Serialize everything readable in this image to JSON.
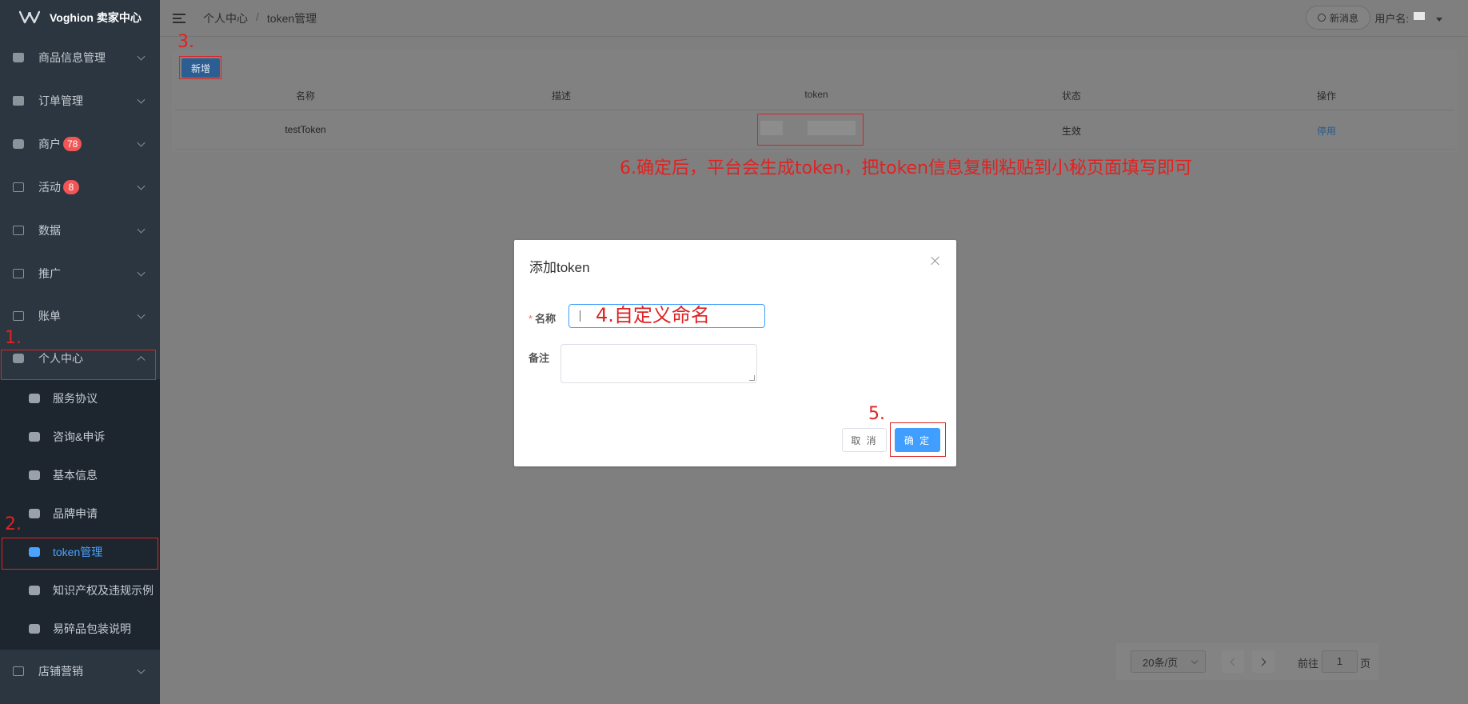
{
  "app": {
    "title": "Voghion 卖家中心"
  },
  "colors": {
    "accent": "#409eff",
    "annotation": "#e02222",
    "sidebar_bg": "#2b3640",
    "badge": "#f25555"
  },
  "sidebar": {
    "items": [
      {
        "label": "商品信息管理",
        "icon": "bag-icon"
      },
      {
        "label": "订单管理",
        "icon": "clipboard-icon"
      },
      {
        "label": "商户",
        "badge": "78",
        "icon": "box-icon"
      },
      {
        "label": "活动",
        "badge": "8",
        "icon": "truck-icon"
      },
      {
        "label": "数据",
        "icon": "truck-icon"
      },
      {
        "label": "推广",
        "icon": "truck-icon"
      },
      {
        "label": "账单",
        "icon": "truck-icon"
      },
      {
        "label": "个人中心",
        "icon": "box-icon",
        "expanded": true
      },
      {
        "label": "店铺营销",
        "icon": "truck-icon"
      }
    ],
    "submenu": [
      {
        "label": "服务协议"
      },
      {
        "label": "咨询&申诉"
      },
      {
        "label": "基本信息"
      },
      {
        "label": "品牌申请"
      },
      {
        "label": "token管理",
        "active": true
      },
      {
        "label": "知识产权及违规示例"
      },
      {
        "label": "易碎品包装说明"
      }
    ]
  },
  "topbar": {
    "breadcrumb": [
      "个人中心",
      "token管理"
    ],
    "separator": "/",
    "message_button": "新消息",
    "user_label": "用户名:"
  },
  "toolbar": {
    "new_button": "新增"
  },
  "table": {
    "columns": [
      "名称",
      "描述",
      "token",
      "状态",
      "操作"
    ],
    "rows": [
      {
        "name": "testToken",
        "description": "",
        "status": "生效",
        "action": "停用"
      }
    ]
  },
  "pagination": {
    "page_size": "20条/页",
    "goto_prefix": "前往",
    "current_page": "1",
    "goto_suffix": "页"
  },
  "modal": {
    "title": "添加token",
    "name_required_mark": "*",
    "name_label": "名称",
    "remark_label": "备注",
    "cancel_button": "取 消",
    "confirm_button": "确 定"
  },
  "annotations": {
    "step1": "1.",
    "step2": "2.",
    "step3": "3.",
    "step4": "4.自定义命名",
    "step5": "5.",
    "step6": "6.确定后，平台会生成token，把token信息复制粘贴到小秘页面填写即可"
  }
}
